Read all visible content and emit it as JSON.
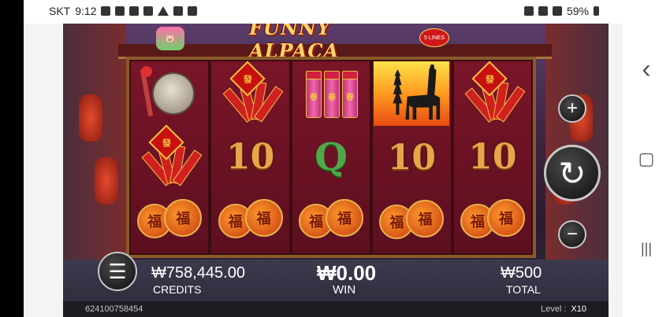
{
  "statusbar": {
    "carrier": "SKT",
    "time": "9:12",
    "battery": "59%"
  },
  "game": {
    "title": "FUNNY ALPACA",
    "lines_badge": "5 LINES",
    "small_logo_text": "🐷",
    "reels": [
      [
        "gong",
        "firecracker-bundle",
        "fu-lanterns"
      ],
      [
        "firecracker-bundle",
        "ten",
        "fu-lanterns"
      ],
      [
        "firecrackers",
        "q",
        "fu-lanterns"
      ],
      [
        "pagoda-alpaca",
        "ten",
        "fu-lanterns"
      ],
      [
        "firecracker-bundle",
        "ten",
        "fu-lanterns"
      ]
    ],
    "symbol_text": {
      "ten": "10",
      "q": "Q",
      "fu": "福",
      "fire_tag": "發",
      "cracker": "春"
    },
    "credits_value": "₩758,445.00",
    "credits_label": "CREDITS",
    "win_value": "₩0.00",
    "win_label": "WIN",
    "total_value": "₩500",
    "total_label": "TOTAL",
    "footer_id": "624100758454",
    "level_label": "Level :",
    "level_value": "X10",
    "buttons": {
      "plus": "+",
      "minus": "−",
      "spin": "↻",
      "menu": "☰"
    }
  },
  "nav": {
    "back": "‹",
    "home": "▢",
    "recents": "|||"
  }
}
